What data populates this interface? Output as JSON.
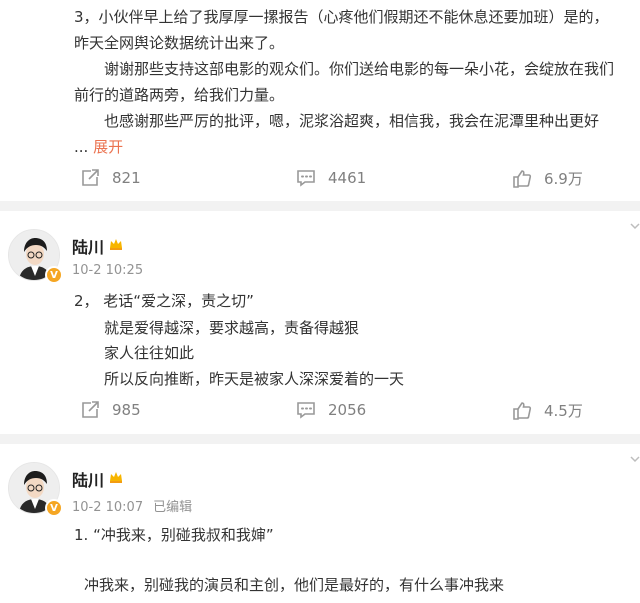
{
  "post_top": {
    "lines": [
      "3，小伙伴早上给了我厚厚一摞报告（心疼他们假期还不能休息还要加班）是的，",
      "昨天全网舆论数据统计出来了。",
      "谢谢那些支持这部电影的观众们。你们送给电影的每一朵小花，会绽放在我们",
      "前行的道路两旁，给我们力量。",
      "也感谢那些严厉的批评，嗯，泥浆浴超爽，相信我，我会在泥潭里种出更好"
    ],
    "ellipsis": "...",
    "expand_label": "展开",
    "repost_count": "821",
    "comment_count": "4461",
    "like_count": "6.9万"
  },
  "post_mid": {
    "author": "陆川",
    "time": "10-2 10:25",
    "lines": [
      "2，  老话“爱之深，责之切”",
      "就是爱得越深，要求越高，责备得越狠",
      "家人往往如此",
      "所以反向推断，昨天是被家人深深爱着的一天"
    ],
    "repost_count": "985",
    "comment_count": "2056",
    "like_count": "4.5万"
  },
  "post_bottom": {
    "author": "陆川",
    "time": "10-2 10:07",
    "edited": "已编辑",
    "lines": [
      "1. “冲我来，别碰我叔和我婶”",
      "冲我来，别碰我的演员和主创，他们是最好的，有什么事冲我来"
    ]
  },
  "colors": {
    "accent_link": "#eb7350",
    "meta_gray": "#939393",
    "divider": "#f2f2f2",
    "badge": "#f5a623"
  }
}
